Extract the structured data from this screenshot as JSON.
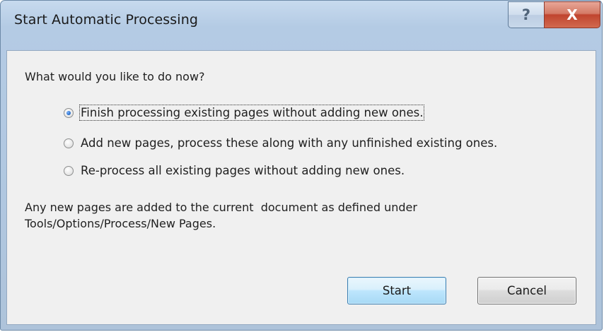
{
  "window": {
    "title": "Start Automatic Processing",
    "help_glyph": "?",
    "close_glyph": "X"
  },
  "dialog": {
    "prompt": "What would you like to do now?",
    "options": [
      {
        "label": "Finish processing existing pages without adding new ones.",
        "mnemonic": "F",
        "checked": true
      },
      {
        "label": "Add new pages, process these along with any unfinished existing ones.",
        "mnemonic": "A",
        "checked": false
      },
      {
        "label": "Re-process all existing pages without adding new ones.",
        "mnemonic": "R",
        "checked": false
      }
    ],
    "info_line1": "Any new pages are added to the current  document as defined under",
    "info_line2": "Tools/Options/Process/New Pages."
  },
  "buttons": {
    "start_label": "Start",
    "cancel_label": "Cancel"
  },
  "icons": {
    "help": "help-icon",
    "close": "close-icon"
  },
  "colors": {
    "frame": "#b4cbe4",
    "client": "#f0f0f0",
    "close_button": "#c0442e",
    "default_button_border": "#3c7fb1"
  }
}
